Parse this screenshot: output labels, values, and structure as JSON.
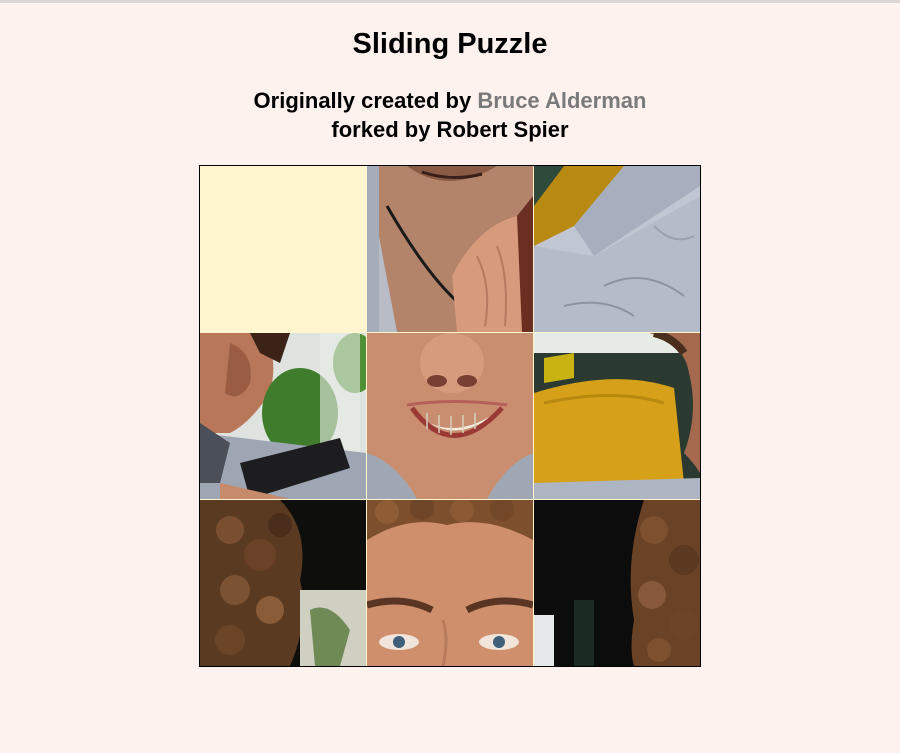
{
  "page": {
    "title": "Sliding Puzzle"
  },
  "credits": {
    "line1_prefix": "Originally created by",
    "author_link": "Bruce Alderman",
    "line2": "forked by Robert Spier"
  },
  "puzzle": {
    "grid_size": 3,
    "empty_cell": 1,
    "tiles": [
      {
        "cell": 2,
        "name": "tile-chin-necklace"
      },
      {
        "cell": 3,
        "name": "tile-shoulder-shirt"
      },
      {
        "cell": 4,
        "name": "tile-ear-hedge-watch"
      },
      {
        "cell": 5,
        "name": "tile-smile"
      },
      {
        "cell": 6,
        "name": "tile-yellow-seat"
      },
      {
        "cell": 7,
        "name": "tile-curly-hair-left"
      },
      {
        "cell": 8,
        "name": "tile-eyes-forehead"
      },
      {
        "cell": 9,
        "name": "tile-curly-hair-right"
      }
    ],
    "colors": {
      "empty": "#fff5cf",
      "background": "#fdf2ee",
      "skin": "#c98c6e",
      "shirt": "#b9bfcb",
      "hair": "#5b3a22",
      "seat": "#d7a21a"
    }
  }
}
